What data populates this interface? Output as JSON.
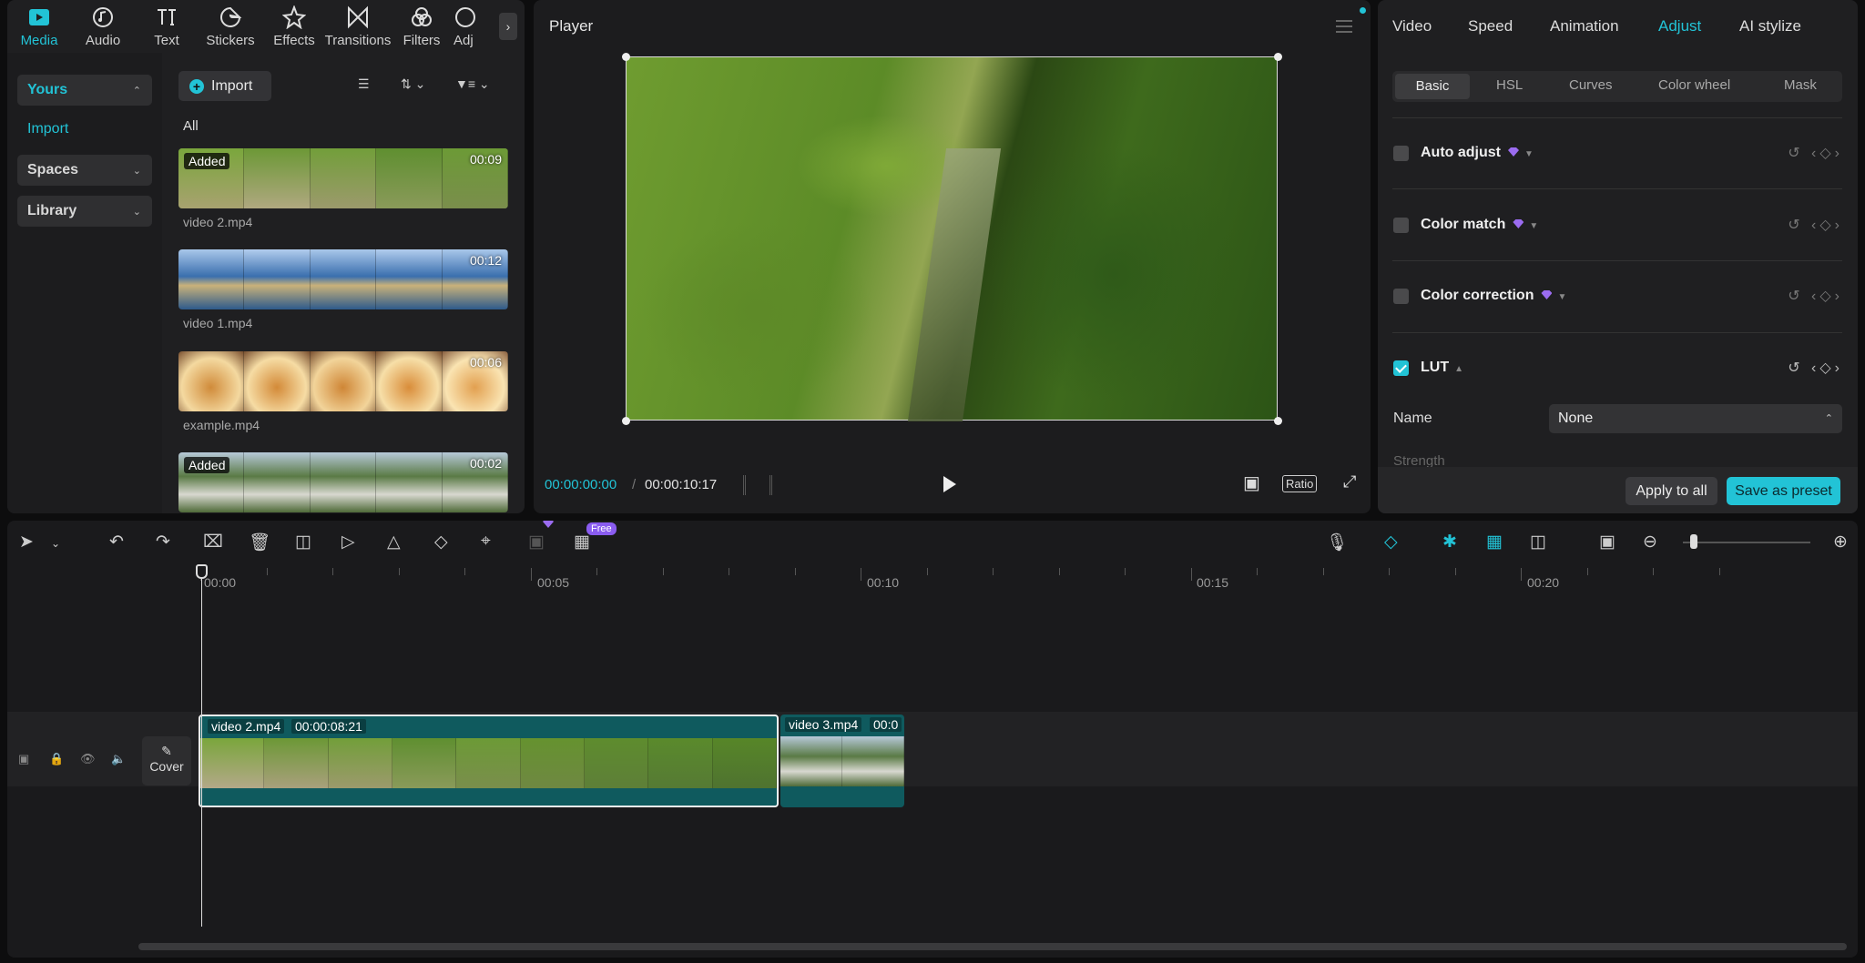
{
  "media_tabs": [
    {
      "label": "Media",
      "icon": "media-icon"
    },
    {
      "label": "Audio",
      "icon": "audio-icon"
    },
    {
      "label": "Text",
      "icon": "text-icon"
    },
    {
      "label": "Stickers",
      "icon": "stickers-icon"
    },
    {
      "label": "Effects",
      "icon": "effects-icon"
    },
    {
      "label": "Transitions",
      "icon": "transitions-icon"
    },
    {
      "label": "Filters",
      "icon": "filters-icon"
    },
    {
      "label": "Adj",
      "icon": "adjust-icon"
    }
  ],
  "sidebar": {
    "yours": "Yours",
    "import": "Import",
    "spaces": "Spaces",
    "library": "Library"
  },
  "media_toolbar": {
    "import_label": "Import",
    "filter_all": "All"
  },
  "media_items": [
    {
      "name": "video 2.mp4",
      "badge": "Added",
      "duration": "00:09"
    },
    {
      "name": "video 1.mp4",
      "badge": "",
      "duration": "00:12"
    },
    {
      "name": "example.mp4",
      "badge": "",
      "duration": "00:06"
    },
    {
      "name": "",
      "badge": "Added",
      "duration": "00:02"
    }
  ],
  "player": {
    "title": "Player",
    "current_time": "00:00:00:00",
    "separator": "/",
    "total_time": "00:00:10:17",
    "ratio_label": "Ratio"
  },
  "props_tabs": [
    "Video",
    "Speed",
    "Animation",
    "Adjust",
    "AI stylize"
  ],
  "props_active_tab": "Adjust",
  "adjust_subtabs": [
    "Basic",
    "HSL",
    "Curves",
    "Color wheel",
    "Mask"
  ],
  "adjust_rows": [
    {
      "label": "Auto adjust",
      "checked": false,
      "premium": true
    },
    {
      "label": "Color match",
      "checked": false,
      "premium": true
    },
    {
      "label": "Color correction",
      "checked": false,
      "premium": true
    },
    {
      "label": "LUT",
      "checked": true,
      "premium": false
    }
  ],
  "lut": {
    "name_label": "Name",
    "name_value": "None",
    "strength_label": "Strength"
  },
  "footer": {
    "apply_all": "Apply to all",
    "save_preset": "Save as preset"
  },
  "timeline": {
    "free_badge": "Free",
    "ruler": [
      "00:00",
      "00:05",
      "00:10",
      "00:15",
      "00:20"
    ],
    "cover_label": "Cover",
    "clips": [
      {
        "name": "video 2.mp4",
        "duration": "00:00:08:21"
      },
      {
        "name": "video 3.mp4",
        "duration": "00:0"
      }
    ]
  },
  "colors": {
    "accent": "#22c3d6",
    "clip": "#0f5a5e",
    "premium": "#9b6cf0"
  }
}
